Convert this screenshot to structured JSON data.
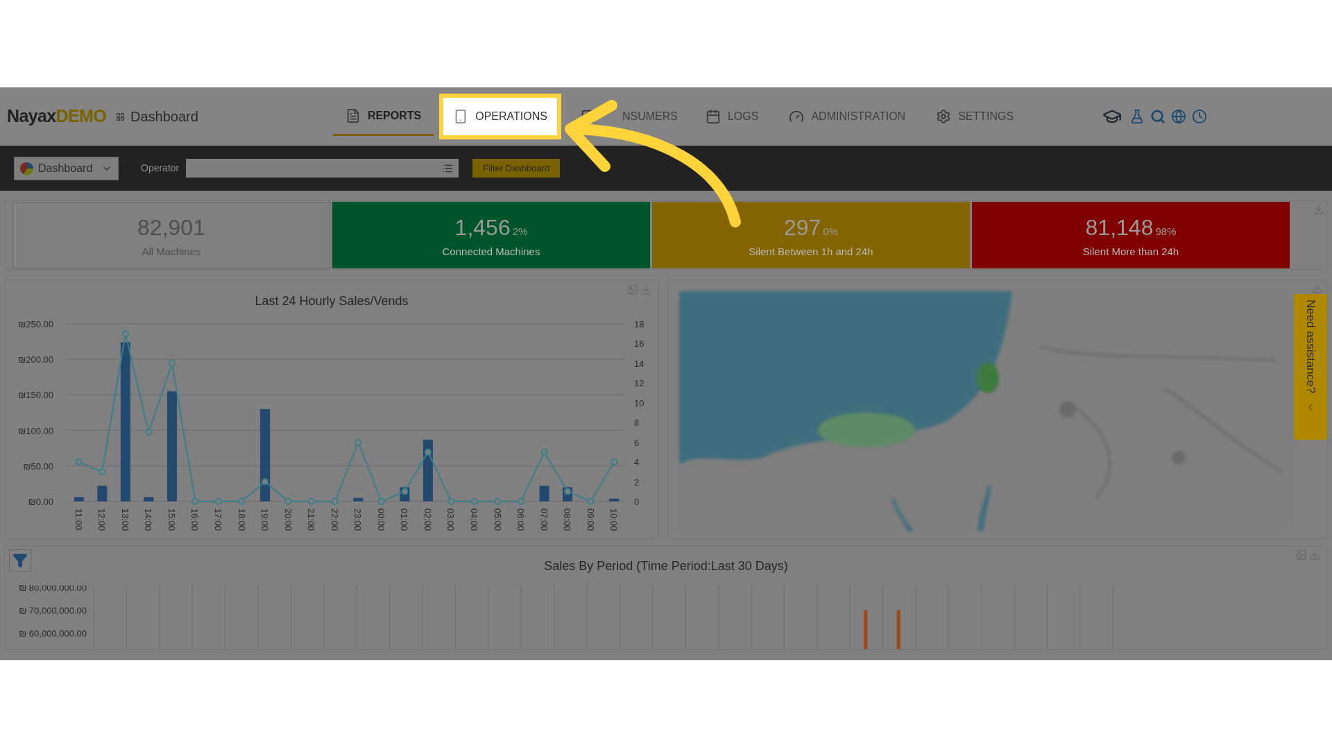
{
  "header": {
    "logo": {
      "brand": "Nayax",
      "suffix": "DEMO"
    },
    "page_title": "Dashboard",
    "tabs": [
      {
        "label": "REPORTS",
        "selected": true,
        "highlighted": false
      },
      {
        "label": "OPERATIONS",
        "selected": false,
        "highlighted": true
      },
      {
        "label": "NSUMERS",
        "selected": false,
        "highlighted": false
      },
      {
        "label": "LOGS",
        "selected": false,
        "highlighted": false
      },
      {
        "label": "ADMINISTRATION",
        "selected": false,
        "highlighted": false
      },
      {
        "label": "SETTINGS",
        "selected": false,
        "highlighted": false
      }
    ]
  },
  "toolbar": {
    "dashboard_select": "Dashboard",
    "operator_label": "Operator",
    "filter_button": "Filter Dashboard"
  },
  "stats": [
    {
      "value": "82,901",
      "label": "All Machines",
      "color": "#808080"
    },
    {
      "value": "1,456",
      "percent": "2%",
      "label": "Connected Machines",
      "color": "#00552a"
    },
    {
      "value": "297",
      "percent": "0%",
      "label": "Silent Between 1h and 24h",
      "color": "#846400"
    },
    {
      "value": "81,148",
      "percent": "98%",
      "label": "Silent More than 24h",
      "color": "#800000"
    }
  ],
  "hourly_chart": {
    "chart_data": {
      "type": "bar",
      "title": "Last 24 Hourly Sales/Vends",
      "categories": [
        "11:00",
        "12:00",
        "13:00",
        "14:00",
        "15:00",
        "16:00",
        "17:00",
        "18:00",
        "19:00",
        "20:00",
        "21:00",
        "22:00",
        "23:00",
        "00:00",
        "01:00",
        "02:00",
        "03:00",
        "04:00",
        "05:00",
        "06:00",
        "07:00",
        "08:00",
        "09:00",
        "10:00"
      ],
      "grid": true,
      "series": [
        {
          "type": "bar",
          "color": "#24496e",
          "values": [
            6,
            22,
            224,
            6,
            155,
            0,
            0,
            0,
            130,
            0,
            0,
            0,
            5,
            0,
            20,
            87,
            0,
            0,
            0,
            0,
            22,
            20,
            0,
            4
          ]
        },
        {
          "type": "line",
          "axis": "y2",
          "marker": "o",
          "color": "#3a7f8c",
          "values": [
            4,
            3,
            17,
            7,
            14,
            0,
            0,
            0,
            2,
            0,
            0,
            0,
            6,
            0,
            1,
            5,
            0,
            0,
            0,
            0,
            5,
            1,
            0,
            4
          ]
        }
      ],
      "ylim": [
        0,
        250
      ],
      "yticks": [
        {
          "value": 0,
          "label": "₪0.00"
        },
        {
          "value": 50,
          "label": "₪50.00"
        },
        {
          "value": 100,
          "label": "₪100.00"
        },
        {
          "value": 150,
          "label": "₪150.00"
        },
        {
          "value": 200,
          "label": "₪200.00"
        },
        {
          "value": 250,
          "label": "₪250.00"
        }
      ],
      "y2lim": [
        0,
        18
      ],
      "y2ticks": [
        0,
        2,
        4,
        6,
        8,
        10,
        12,
        14,
        16,
        18
      ]
    }
  },
  "map": {
    "kind": "picture",
    "assistance_tab": "Need assistance?"
  },
  "period_chart": {
    "title": "Sales By Period (Time Period:Last 30 Days)",
    "axis_labels": [
      "₪ 80,000,000.00",
      "₪ 70,000,000.00",
      "₪ 60,000,000.00"
    ]
  }
}
